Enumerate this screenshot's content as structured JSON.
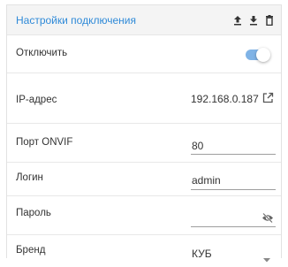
{
  "header": {
    "title": "Настройки подключения"
  },
  "fields": {
    "disable": {
      "label": "Отключить",
      "enabled": true
    },
    "ip": {
      "label": "IP-адрес",
      "value": "192.168.0.187"
    },
    "port": {
      "label": "Порт ONVIF",
      "value": "80"
    },
    "login": {
      "label": "Логин",
      "value": "admin"
    },
    "password": {
      "label": "Пароль",
      "value": ""
    },
    "brand": {
      "label": "Бренд",
      "value": "КУБ"
    }
  },
  "colors": {
    "accent": "#2f8ad8",
    "toggle": "#7fb3e6"
  },
  "icons": [
    "upload-icon",
    "download-icon",
    "trash-icon",
    "external-link-icon",
    "eye-off-icon",
    "chevron-down-icon"
  ]
}
